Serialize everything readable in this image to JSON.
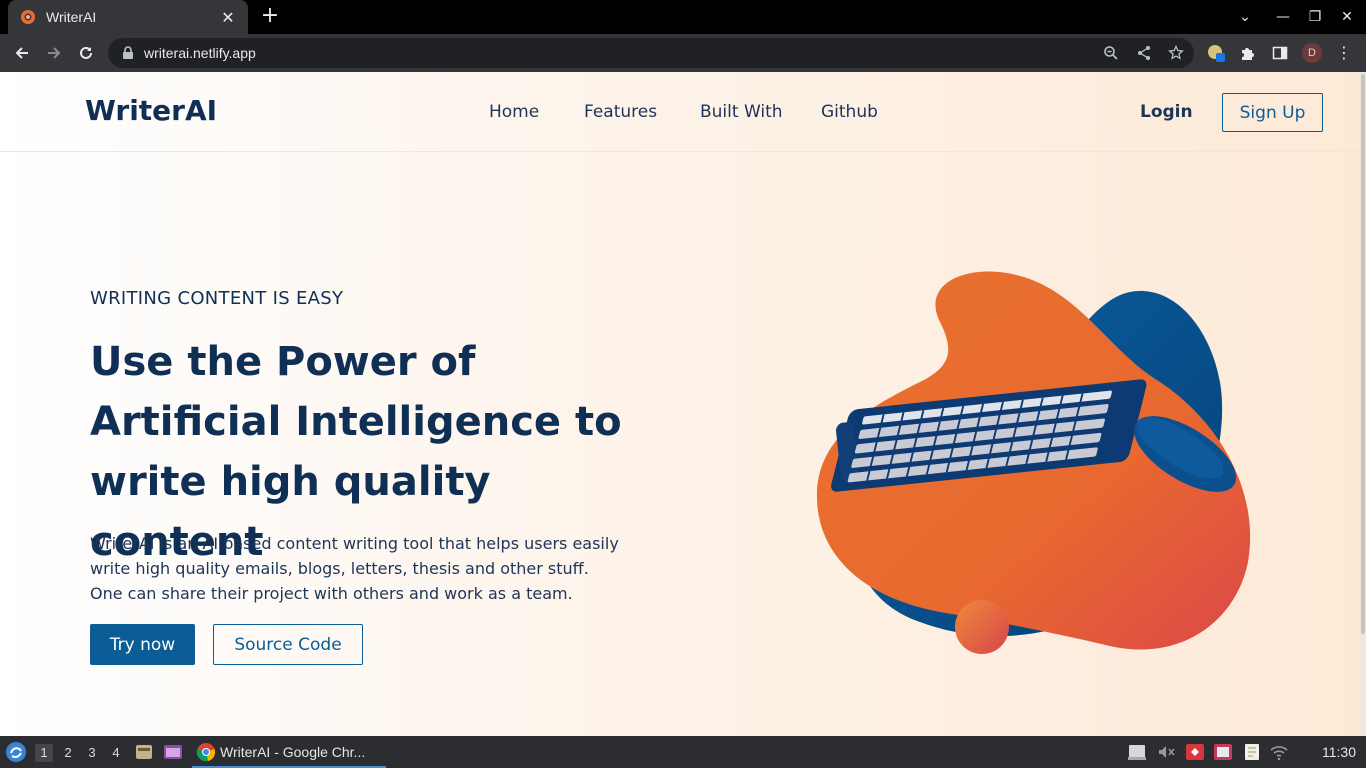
{
  "browser": {
    "tab_title": "WriterAI",
    "url": "writerai.netlify.app",
    "profile_initial": "D",
    "new_tab_symbol": "+",
    "tab_close_symbol": "✕",
    "menu_symbol": "⋮",
    "window_controls": {
      "dropdown": "⌄",
      "minimize": "—",
      "restore": "❐",
      "close": "✕"
    }
  },
  "site": {
    "brand": "WriterAI",
    "nav": [
      "Home",
      "Features",
      "Built With",
      "Github"
    ],
    "login": "Login",
    "signup": "Sign Up"
  },
  "hero": {
    "eyebrow": "WRITING CONTENT IS EASY",
    "headline": "Use the Power of Artificial Intelligence to write high quality content",
    "description": "WriterAI is an AI based content writing tool that helps users easily write high quality emails, blogs, letters, thesis and other stuff. One can share their project with others and work as a team.",
    "try_now": "Try now",
    "source_code": "Source Code"
  },
  "taskbar": {
    "workspaces": [
      "1",
      "2",
      "3",
      "4"
    ],
    "active_workspace": "1",
    "task_label": "WriterAI - Google Chr...",
    "clock": "11:30"
  },
  "colors": {
    "brand_navy": "#0f2f55",
    "accent_blue": "#0a5d95",
    "blob_orange": "#e86e30",
    "blob_blue": "#0b5a93"
  },
  "icons": {
    "back": "arrow-left-icon",
    "forward": "arrow-right-icon",
    "reload": "reload-icon",
    "lock": "lock-icon",
    "zoom": "zoom-icon",
    "share": "share-icon",
    "bookmark": "star-icon",
    "extensions": "puzzle-icon",
    "side_panel": "side-panel-icon"
  }
}
